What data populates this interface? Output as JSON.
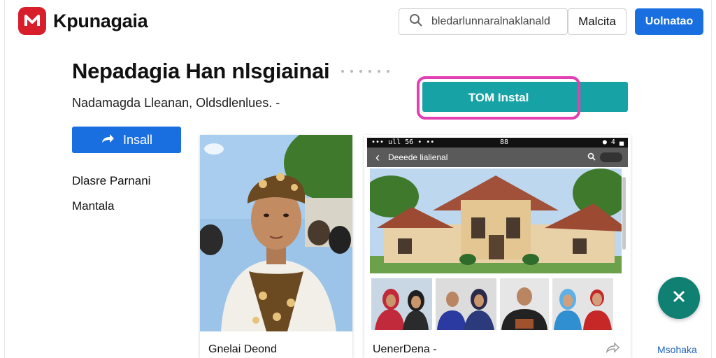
{
  "brand": {
    "name": "Kpunagaia",
    "logo_letter": "M",
    "color": "#d81e2a"
  },
  "header": {
    "search_placeholder": "bledarlunnaralnaklanald",
    "secondary_button": "Malcita",
    "primary_button": "Uolnatao"
  },
  "hero": {
    "title": "Nepadagia Han nlsgiainai",
    "subtitle": "Nadamagda Lleanan, Oldsdlenlues. -",
    "cta_label": "TOM Instal",
    "install_button": "Insall",
    "meta_1": "Dlasre Parnani",
    "meta_2": "Mantala"
  },
  "cards": [
    {
      "caption": "Gnelai Deond"
    },
    {
      "caption": "UenerDena -",
      "phone": {
        "status_left": "••• ull 56 • ••",
        "status_center": "88",
        "status_right": "● 4 ▄",
        "app_title": "Deeede lialienal"
      }
    }
  ],
  "footer": {
    "link": "Msohaka"
  },
  "colors": {
    "accent": "#1a6fe0",
    "cta": "#17a3a5",
    "highlight": "#e33fb2",
    "fab": "#0f8072"
  },
  "icons": [
    "search-icon",
    "arrow-icon",
    "share-icon",
    "close-icon",
    "back-icon"
  ]
}
